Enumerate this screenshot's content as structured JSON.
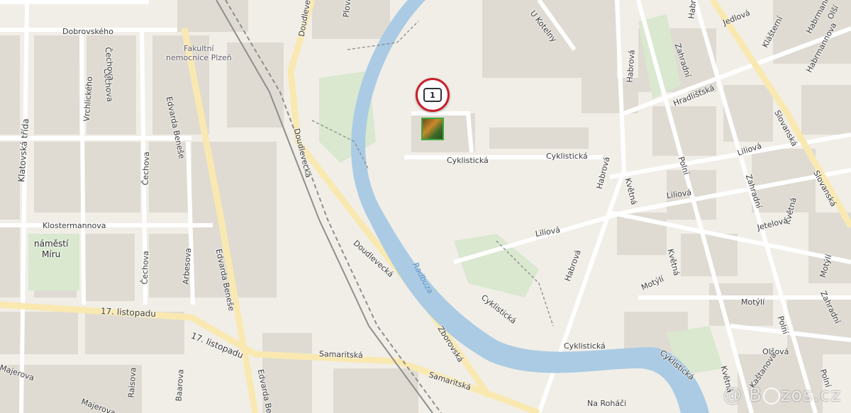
{
  "map": {
    "listing_count": "1",
    "watermark": {
      "at": "@",
      "brand": "bazos.cz",
      "prefix": "B",
      "suffix": "zos.cz"
    },
    "colors": {
      "land": "#f1eee8",
      "block": "#dfdbd3",
      "road": "#ffffff",
      "main_road": "#f9e9b0",
      "water": "#aacbe3",
      "park": "#d9e8cf",
      "rail": "#8e8e8e",
      "marker_ring": "#c8202b"
    },
    "river": "Radbuza",
    "poi": "Fakultní\nnemocnice Plzeň",
    "square": "náměstí\nMíru",
    "streets": {
      "dobrovskeho": "Dobrovského",
      "klatovska": "Klatovská třída",
      "vrchlickeho": "Vrchlického",
      "cechova1": "Čechova",
      "cechova2": "Čechova",
      "cechova3": "Čechova",
      "cechova4": "Čechova",
      "edvarda1": "Edvarda Beneše",
      "edvarda2": "Edvarda Beneše",
      "edvarda3": "Edvarda Beneše",
      "klostermannova": "Klostermannova",
      "arbesova": "Arbesova",
      "listopadu1": "17. listopadu",
      "listopadu2": "17. listopadu",
      "samaritska1": "Samaritská",
      "samaritska2": "Samaritská",
      "majerova1": "Majerova",
      "majerova2": "Majerova",
      "raisova": "Raisova",
      "baarova": "Baarova",
      "doudlevecka1": "Doudlevecká",
      "doudlevecka2": "Doudlevecká",
      "doudlevecka3": "Doudlevecká",
      "plovarni": "Plovární",
      "zborovska": "Zborovská",
      "ukotelny": "U Kotelny",
      "cyklisticka1": "Cyklistická",
      "cyklisticka2": "Cyklistická",
      "cyklisticka3": "Cyklistická",
      "cyklisticka4": "Cyklistická",
      "cyklisticka5": "Cyklistická",
      "habrova1": "Habrová",
      "habrova2": "Habrová",
      "habrova3": "Habrová",
      "habrova4": "Habrová",
      "liliova1": "Liliová",
      "liliova2": "Liliová",
      "liliova3": "Liliová",
      "kvetna1": "Květná",
      "kvetna2": "Květná",
      "kvetna3": "Květná",
      "kvetna4": "Květná",
      "zahradni1": "Zahradní",
      "zahradni2": "Zahradní",
      "zahradni3": "Zahradní",
      "polni1": "Polní",
      "polni2": "Polní",
      "polni3": "Polní",
      "jedlova": "Jedlová",
      "hradlistska": "Hradlišťská",
      "klasterni": "Klášterní",
      "habrmannova1": "Habrmannova",
      "habrmannova2": "Habrmannova",
      "slovanska1": "Slovanská",
      "slovanska2": "Slovanská",
      "jetelova": "Jetelová",
      "motyli1": "Motýlí",
      "motyli2": "Motýlí",
      "motyli3": "Motýlí",
      "olsova": "Olšová",
      "kastanova": "Kaštanová",
      "olsi": "Olší",
      "naj": "Na Roháči"
    }
  }
}
